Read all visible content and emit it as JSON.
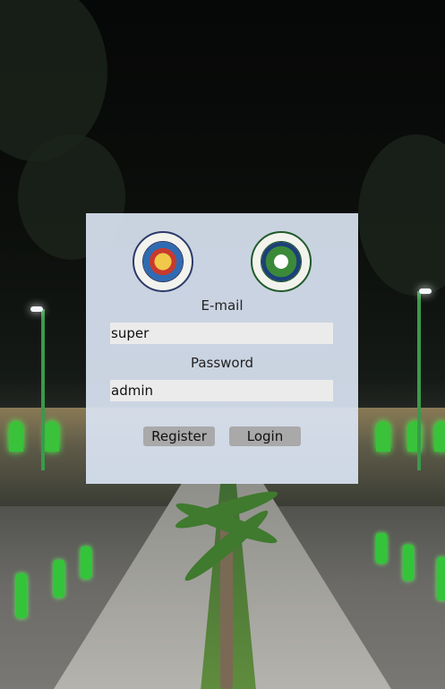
{
  "login": {
    "logos": {
      "left": "City of Cotabato official seal",
      "right": "Barangay Datu Usman Bangingen Cotabato City seal"
    },
    "email_label": "E-mail",
    "email_value": "super",
    "password_label": "Password",
    "password_value": "admin",
    "register_label": "Register",
    "login_label": "Login"
  },
  "colors": {
    "panel_bg": "#dae4f3",
    "field_bg": "#ebebeb",
    "button_bg": "#a9a9a9"
  }
}
